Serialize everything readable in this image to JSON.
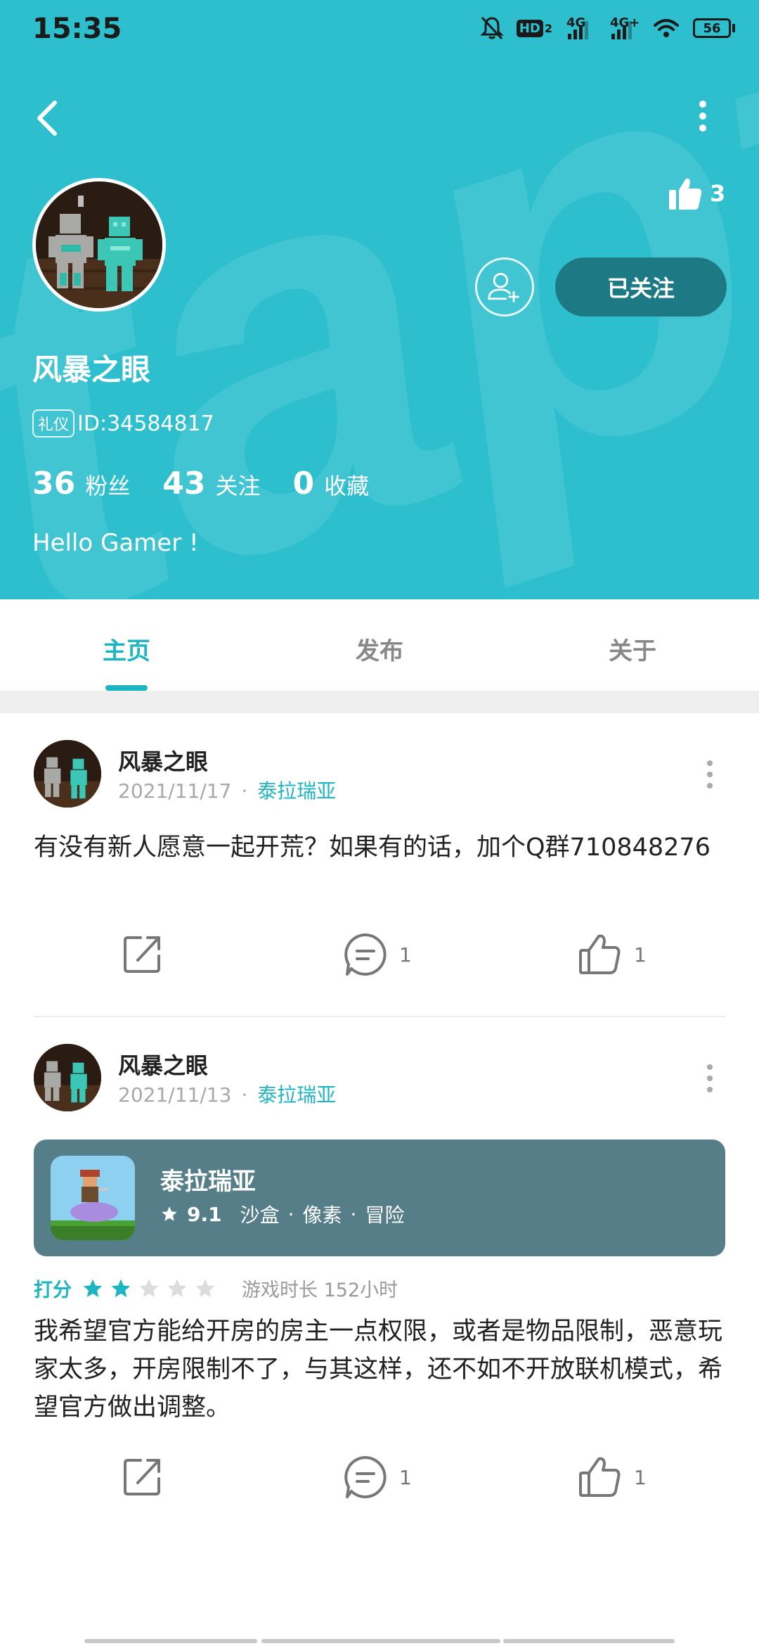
{
  "status_bar": {
    "time": "15:35",
    "hd_label": "HD",
    "net1": "4G",
    "net2": "4G+",
    "battery": "56"
  },
  "profile": {
    "like_count": "3",
    "follow_label": "已关注",
    "username": "风暴之眼",
    "badge": "礼仪",
    "id_text": "ID:34584817",
    "stats": [
      {
        "num": "36",
        "label": "粉丝"
      },
      {
        "num": "43",
        "label": "关注"
      },
      {
        "num": "0",
        "label": "收藏"
      }
    ],
    "bio": "Hello Gamer !"
  },
  "tabs": [
    "主页",
    "发布",
    "关于"
  ],
  "posts": [
    {
      "author": "风暴之眼",
      "date": "2021/11/17",
      "game": "泰拉瑞亚",
      "content": "有没有新人愿意一起开荒？如果有的话，加个Q群710848276",
      "comments": "1",
      "likes": "1"
    },
    {
      "author": "风暴之眼",
      "date": "2021/11/13",
      "game": "泰拉瑞亚",
      "card": {
        "name": "泰拉瑞亚",
        "score": "9.1",
        "tags": [
          "沙盒",
          "像素",
          "冒险"
        ]
      },
      "rating_label": "打分",
      "rating": 2,
      "rating_max": 5,
      "play_time": "游戏时长 152小时",
      "content": "我希望官方能给开房的房主一点权限，或者是物品限制，恶意玩家太多，开房限制不了，与其这样，还不如不开放联机模式，希望官方做出调整。",
      "comments": "1",
      "likes": "1"
    }
  ],
  "colors": {
    "header_bg": "#2dbfcd",
    "accent": "#1eb5c3",
    "follow_btn": "#1d7a84",
    "game_card": "#567e88"
  }
}
